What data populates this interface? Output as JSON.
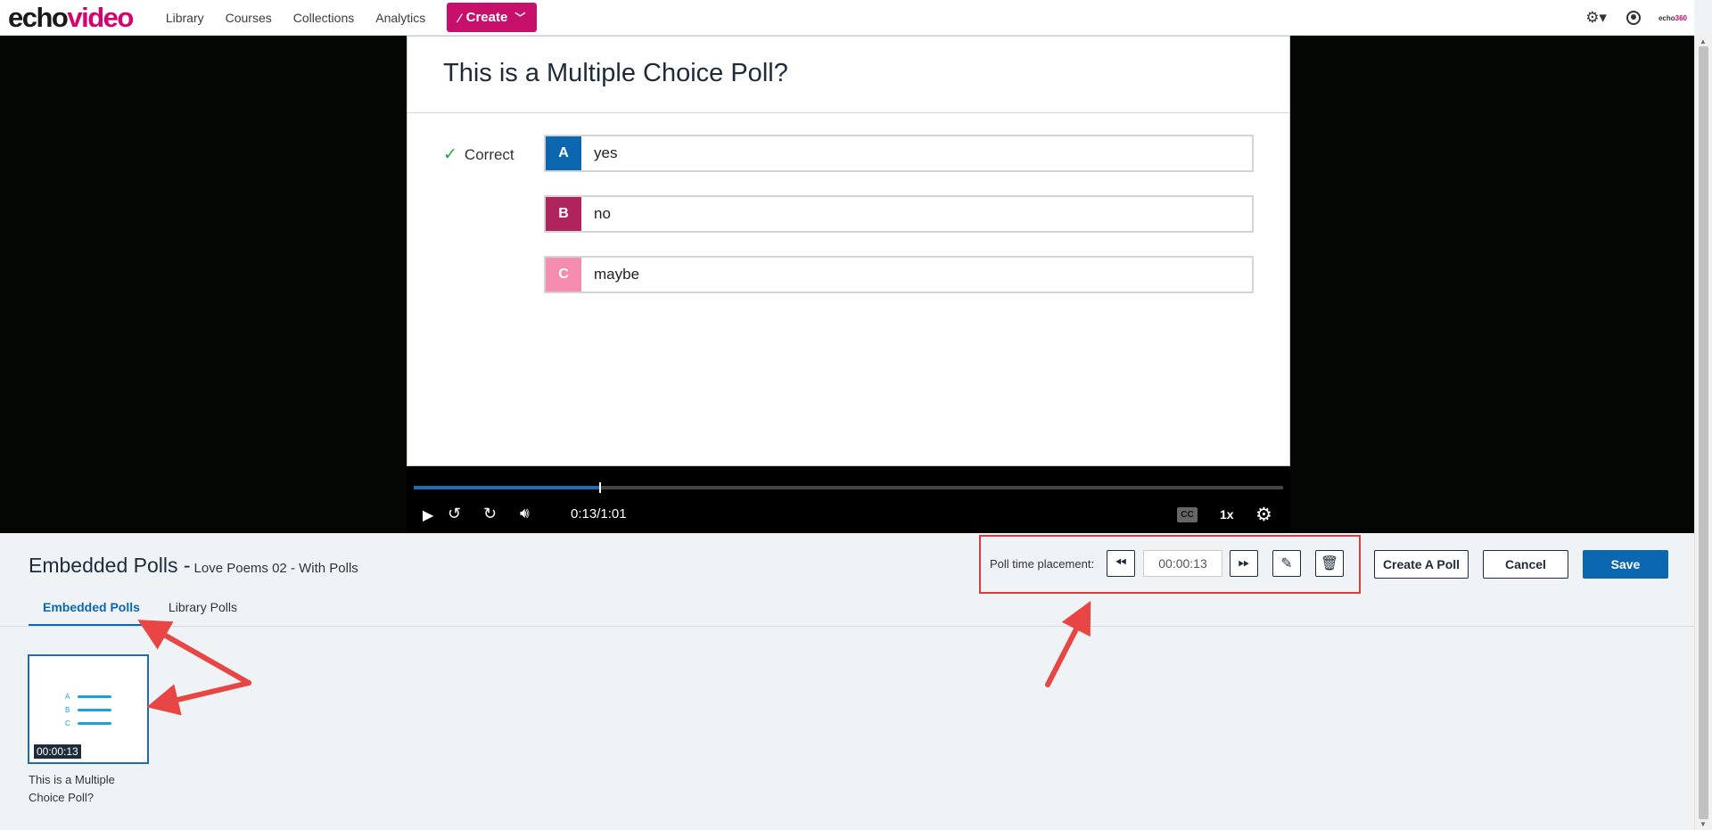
{
  "nav": {
    "logo_part1": "echo",
    "logo_part2": "video",
    "links": [
      "Library",
      "Courses",
      "Collections",
      "Analytics"
    ],
    "create_label": "Create",
    "mini_logo_a": "echo",
    "mini_logo_b": "360"
  },
  "poll": {
    "question": "This is a Multiple Choice Poll?",
    "correct_label": "Correct",
    "answers": [
      {
        "letter": "A",
        "text": "yes",
        "color": "#0a67b0"
      },
      {
        "letter": "B",
        "text": "no",
        "color": "#b0245e"
      },
      {
        "letter": "C",
        "text": "maybe",
        "color": "#f68cb0"
      }
    ]
  },
  "player": {
    "time": "0:13/1:01",
    "cc_label": "CC",
    "speed": "1x",
    "progress_fraction": 0.2131
  },
  "editor": {
    "title": "Embedded Polls -",
    "media_title": "Love Poems 02 - With Polls",
    "placement_label": "Poll time placement:",
    "placement_time": "00:00:13",
    "create_poll_label": "Create A Poll",
    "cancel_label": "Cancel",
    "save_label": "Save"
  },
  "tabs": [
    "Embedded Polls",
    "Library Polls"
  ],
  "poll_cards": [
    {
      "timestamp": "00:00:13",
      "caption": "This is a Multiple Choice Poll?",
      "letters": [
        "A",
        "B",
        "C"
      ]
    }
  ]
}
